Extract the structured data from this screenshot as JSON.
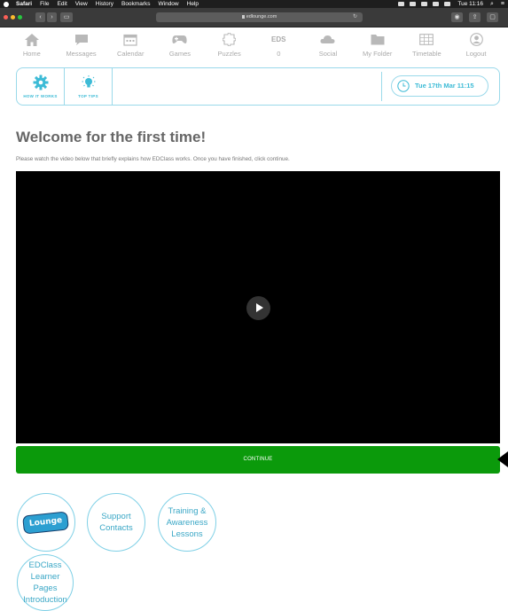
{
  "menubar": {
    "items": [
      "Safari",
      "File",
      "Edit",
      "View",
      "History",
      "Bookmarks",
      "Window",
      "Help"
    ],
    "clock": "Tue 11:16"
  },
  "browser": {
    "url": "edlounge.com"
  },
  "nav": {
    "items": [
      {
        "label": "Home",
        "icon": "home-icon"
      },
      {
        "label": "Messages",
        "icon": "messages-icon"
      },
      {
        "label": "Calendar",
        "icon": "calendar-icon"
      },
      {
        "label": "Games",
        "icon": "gamepad-icon"
      },
      {
        "label": "Puzzles",
        "icon": "puzzle-icon"
      },
      {
        "label": "0",
        "icon_text": "EDS"
      },
      {
        "label": "Social",
        "icon": "cloud-icon"
      },
      {
        "label": "My Folder",
        "icon": "folder-icon"
      },
      {
        "label": "Timetable",
        "icon": "timetable-icon"
      },
      {
        "label": "Logout",
        "icon": "user-icon"
      }
    ]
  },
  "tips": {
    "how_it_works": "HOW IT WORKS",
    "top_tips": "TOP TIPS",
    "date": "Tue 17th Mar 11:15"
  },
  "page": {
    "title": "Welcome for the first time!",
    "intro": "Please watch the video below that briefly explains how EDClass works. Once you have finished, click continue.",
    "continue_label": "CONTINUE"
  },
  "links": {
    "logo_text": "Lounge",
    "support": [
      "Support",
      "Contacts"
    ],
    "training": [
      "Training &",
      "Awareness",
      "Lessons"
    ],
    "edclass": [
      "EDClass",
      "Learner Pages",
      "Introduction"
    ]
  },
  "colors": {
    "accent": "#3dbbd6",
    "continue": "#0b9a0b",
    "nav_icon": "#aaaaaa"
  }
}
